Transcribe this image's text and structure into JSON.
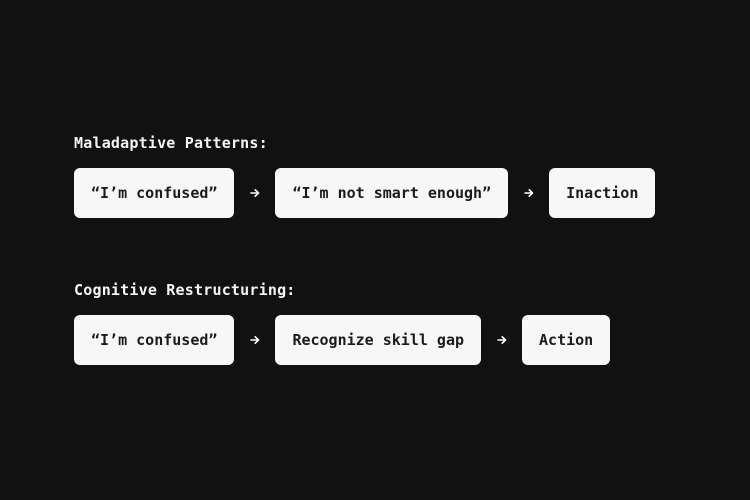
{
  "colors": {
    "background": "#111111",
    "node_fill": "#f7f7f7",
    "node_text": "#1b1b1b",
    "arrow": "#ffffff"
  },
  "sections": [
    {
      "title": "Maladaptive Patterns:",
      "steps": [
        "“I’m confused”",
        "“I’m not smart enough”",
        "Inaction"
      ]
    },
    {
      "title": "Cognitive Restructuring:",
      "steps": [
        "“I’m confused”",
        "Recognize skill gap",
        "Action"
      ]
    }
  ],
  "connector_icon": "arrow-right-icon"
}
